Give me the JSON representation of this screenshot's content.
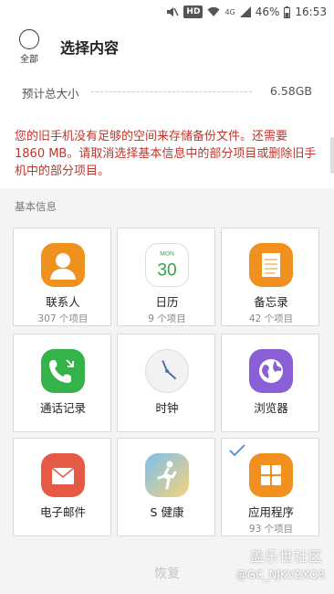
{
  "status": {
    "hd": "HD",
    "signal_label": "4G",
    "battery": "46%",
    "time": "16:53"
  },
  "header": {
    "select_all_label": "全部",
    "title": "选择内容"
  },
  "estimate": {
    "label": "预计总大小",
    "value": "6.58GB"
  },
  "warning": "您的旧手机没有足够的空间来存储备份文件。还需要 1860 MB。请取消选择基本信息中的部分项目或删除旧手机中的部分项目。",
  "section": {
    "title": "基本信息"
  },
  "items": [
    {
      "name": "联系人",
      "count": "307 个项目",
      "icon": "contacts-icon",
      "color": "#f0901e"
    },
    {
      "name": "日历",
      "count": "9 个项目",
      "icon": "calendar-icon",
      "color": "#ffffff",
      "cal_month": "MON",
      "cal_day": "30"
    },
    {
      "name": "备忘录",
      "count": "42 个项目",
      "icon": "memo-icon",
      "color": "#f0901e"
    },
    {
      "name": "通话记录",
      "count": "",
      "icon": "call-log-icon",
      "color": "#34b34a"
    },
    {
      "name": "时钟",
      "count": "",
      "icon": "clock-icon",
      "color": "#f2f2f2"
    },
    {
      "name": "浏览器",
      "count": "",
      "icon": "browser-icon",
      "color": "#8b5fd6"
    },
    {
      "name": "电子邮件",
      "count": "",
      "icon": "email-icon",
      "color": "#e65a45"
    },
    {
      "name": "S 健康",
      "count": "",
      "icon": "s-health-icon",
      "color": "#6ab0e8"
    },
    {
      "name": "应用程序",
      "count": "93 个项目",
      "icon": "apps-icon",
      "color": "#f0901e"
    }
  ],
  "bottom": {
    "restore_label": "恢复"
  },
  "watermark": {
    "line1": "盖乐世社区",
    "line2": "@GC_NJKV2XQ3"
  }
}
